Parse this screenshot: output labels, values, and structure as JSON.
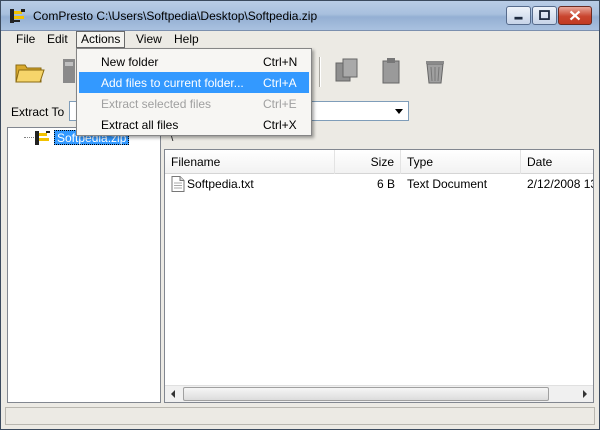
{
  "window": {
    "title": "ComPresto C:\\Users\\Softpedia\\Desktop\\Softpedia.zip",
    "accent": "#3399ff"
  },
  "menubar": {
    "items": [
      {
        "label": "File"
      },
      {
        "label": "Edit"
      },
      {
        "label": "Actions"
      },
      {
        "label": "View"
      },
      {
        "label": "Help"
      }
    ]
  },
  "toolbar": {
    "icons": [
      "open-folder-icon",
      "extract-icon",
      "copy-icon",
      "move-icon",
      "delete-icon"
    ]
  },
  "extract": {
    "label": "Extract To",
    "value": ""
  },
  "actions_menu": {
    "items": [
      {
        "label": "New folder",
        "shortcut": "Ctrl+N",
        "state": "enabled"
      },
      {
        "label": "Add files to current folder...",
        "shortcut": "Ctrl+A",
        "state": "highlighted"
      },
      {
        "label": "Extract selected files",
        "shortcut": "Ctrl+E",
        "state": "disabled"
      },
      {
        "label": "Extract all files",
        "shortcut": "Ctrl+X",
        "state": "enabled"
      }
    ]
  },
  "tree": {
    "root_label": "Softpedia.zip"
  },
  "path": {
    "text": "\\"
  },
  "file_list": {
    "columns": [
      "Filename",
      "Size",
      "Type",
      "Date"
    ],
    "rows": [
      {
        "name": "Softpedia.txt",
        "size": "6 B",
        "type": "Text Document",
        "date": "2/12/2008 13"
      }
    ]
  },
  "status": {
    "text": ""
  }
}
